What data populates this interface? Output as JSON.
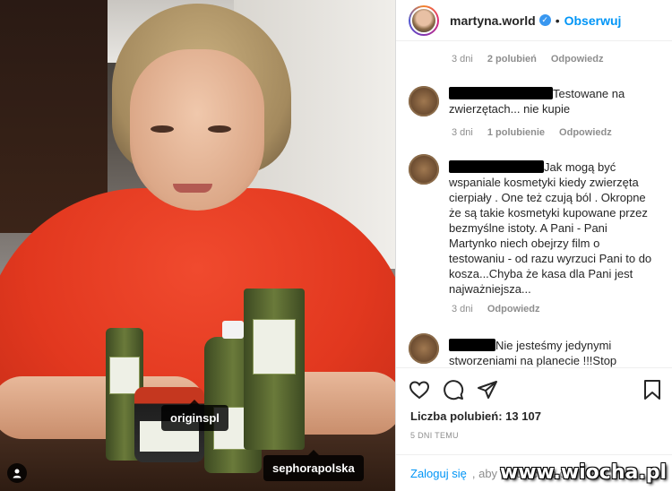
{
  "post": {
    "tags": [
      "originspl",
      "sephorapolska"
    ]
  },
  "header": {
    "username": "martyna.world",
    "separator": "•",
    "follow_label": "Obserwuj"
  },
  "comments": [
    {
      "meta_time": "3 dni",
      "meta_likes": "2 polubień",
      "meta_reply": "Odpowiedz"
    },
    {
      "text": "Testowane na zwierzętach... nie kupie",
      "meta_time": "3 dni",
      "meta_likes": "1 polubienie",
      "meta_reply": "Odpowiedz"
    },
    {
      "text": "Jak mogą być wspaniale kosmetyki kiedy zwierzęta cierpiały . One też czują ból . Okropne że są takie kosmetyki kupowane przez bezmyślne istoty. A Pani - Pani Martynko niech obejrzy film o testowaniu - od razu wyrzuci Pani to do kosza...Chyba że kasa dla Pani jest najważniejsza...",
      "meta_time": "3 dni",
      "meta_reply": "Odpowiedz"
    },
    {
      "text": "Nie jesteśmy jedynymi stworzeniami na planecie !!!Stop"
    }
  ],
  "actions": {
    "likes_text": "Liczba polubień: 13 107",
    "time_ago": "5 DNI TEMU",
    "login_link": "Zaloguj się",
    "login_rest": ", aby polubić lub d"
  },
  "watermark": "www.wiocha.pl",
  "icons": [
    "heart-icon",
    "comment-icon",
    "share-icon",
    "bookmark-icon",
    "verified-badge-icon",
    "user-tag-icon"
  ],
  "colors": {
    "accent": "#0095f6",
    "verified": "#3897f0",
    "muted": "#8e8e8e"
  }
}
